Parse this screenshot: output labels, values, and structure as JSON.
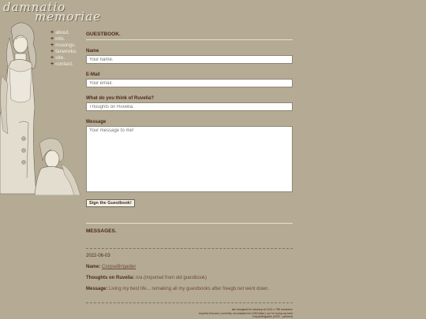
{
  "site": {
    "logo_line1": "damnatio",
    "logo_line2": "memoriae"
  },
  "nav": [
    {
      "label": "about."
    },
    {
      "label": "info."
    },
    {
      "label": "musings."
    },
    {
      "label": "fanworks."
    },
    {
      "label": "site."
    },
    {
      "label": "contact."
    }
  ],
  "guestbook": {
    "title": "GUESTBOOK.",
    "name_label": "Name",
    "name_placeholder": "Your name.",
    "email_label": "E-Mail",
    "email_placeholder": "Your email.",
    "opinion_label": "What do you think of Ruvelia?",
    "opinion_placeholder": "Thoughts on Ruvelia.",
    "message_label": "Message",
    "message_placeholder": "Your message to me!",
    "submit_label": "Sign the Guestbook!"
  },
  "messages": {
    "title": "MESSAGES.",
    "entries": [
      {
        "date": "2022-06-03",
        "name_key": "Name:",
        "name": "CorpseBrigadier",
        "thoughts_key": "Thoughts on Ruvelia:",
        "thoughts": "n/a (imported from old guestbook)",
        "message_key": "Message:",
        "message": "Living my best life... remaking all my guestbooks after freegb.net went down."
      }
    ]
  },
  "footer": {
    "line1": "site designed for desktop at 1024 x 768 resolution",
    "line2": "requires thecans | currently not adapted for iOS/Safari | sui I'm trying my best",
    "line3": "CorpseBrigadier (2022 - present)"
  },
  "colors": {
    "background": "#b5ab95",
    "accent": "#4a2a18",
    "link": "#6e4a36"
  }
}
